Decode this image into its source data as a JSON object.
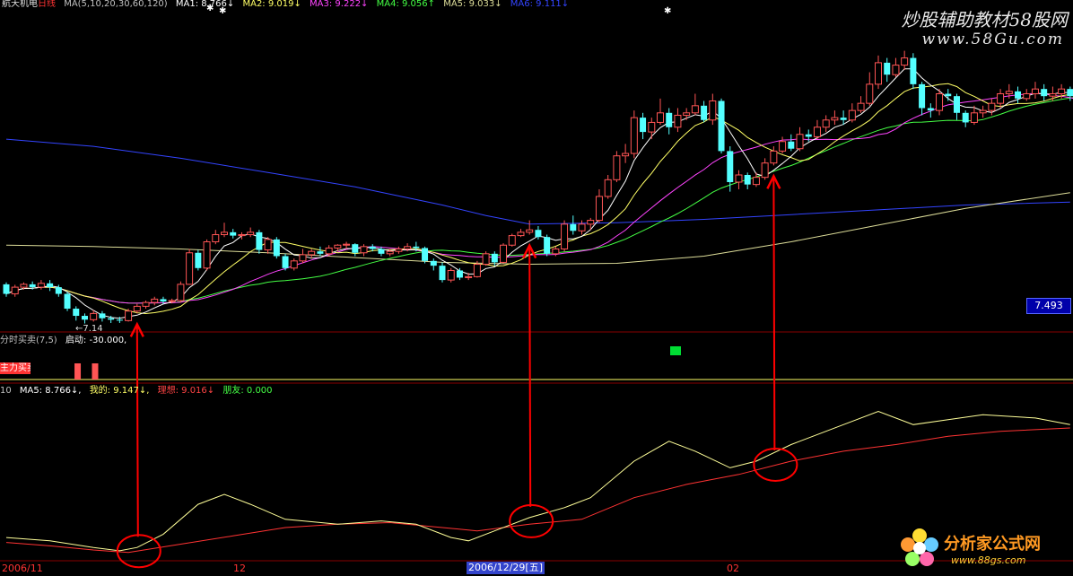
{
  "header": {
    "stock": "航天机电",
    "period": "日线",
    "ma_params": "MA(5,10,20,30,60,120)",
    "ma1": "MA1: 8.766↓",
    "ma2": "MA2: 9.019↓",
    "ma3": "MA3: 9.222↓",
    "ma4": "MA4: 9.056↑",
    "ma5": "MA5: 9.033↓",
    "ma6": "MA6: 9.111↓"
  },
  "watermark": {
    "title": "炒股辅助教材58股网",
    "url": "www.58Gu.com",
    "logo_text": "分析家公式网",
    "logo_url": "www.88gs.com"
  },
  "indicator1": {
    "title": "分时买卖(7,5)",
    "param": "启动: -30.000,",
    "tag": "主力买卖"
  },
  "indicator2": {
    "prefix": "10",
    "ma5": "MA5: 8.766↓,",
    "mine": "我的: 9.147↓,",
    "theory": "理想: 9.016↓",
    "friend": "朋友: 0.000"
  },
  "price_tag": "7.493",
  "low_label": "←7.14",
  "xaxis": {
    "nov": "2006/11",
    "dec": "12",
    "cursor_date": "2006/12/29[五]",
    "feb": "02"
  },
  "colors": {
    "up": "#ff5555",
    "down": "#54ffff",
    "ma5": "#ffffff",
    "ma10": "#ffff66",
    "ma20": "#ff44ff",
    "ma30": "#44ff44",
    "ma60": "#dddd99",
    "ma120": "#3344ff",
    "annotation": "#ff0000"
  },
  "chart_data": {
    "type": "candlestick",
    "candles": [
      [
        7.96,
        7.76,
        8.0,
        7.7
      ],
      [
        7.76,
        7.9,
        7.95,
        7.7
      ],
      [
        7.9,
        7.96,
        8.0,
        7.85
      ],
      [
        7.96,
        7.9,
        8.02,
        7.85
      ],
      [
        7.9,
        7.98,
        8.05,
        7.85
      ],
      [
        7.98,
        7.9,
        8.05,
        7.82
      ],
      [
        7.9,
        7.76,
        7.95,
        7.7
      ],
      [
        7.76,
        7.45,
        7.8,
        7.4
      ],
      [
        7.45,
        7.3,
        7.5,
        7.2
      ],
      [
        7.3,
        7.22,
        7.35,
        7.14
      ],
      [
        7.22,
        7.35,
        7.42,
        7.18
      ],
      [
        7.35,
        7.25,
        7.4,
        7.18
      ],
      [
        7.25,
        7.22,
        7.3,
        7.15
      ],
      [
        7.22,
        7.2,
        7.28,
        7.15
      ],
      [
        7.2,
        7.4,
        7.45,
        7.18
      ],
      [
        7.4,
        7.5,
        7.55,
        7.35
      ],
      [
        7.5,
        7.58,
        7.62,
        7.45
      ],
      [
        7.58,
        7.65,
        7.7,
        7.52
      ],
      [
        7.65,
        7.6,
        7.7,
        7.55
      ],
      [
        7.6,
        7.62,
        7.66,
        7.56
      ],
      [
        7.62,
        7.96,
        8.02,
        7.58
      ],
      [
        7.96,
        8.62,
        8.7,
        7.95
      ],
      [
        8.62,
        8.3,
        8.68,
        8.25
      ],
      [
        8.3,
        8.85,
        8.9,
        8.25
      ],
      [
        8.85,
        9.0,
        9.1,
        8.8
      ],
      [
        9.0,
        9.05,
        9.25,
        8.95
      ],
      [
        9.05,
        8.98,
        9.12,
        8.92
      ],
      [
        8.98,
        9.0,
        9.05,
        8.9
      ],
      [
        9.0,
        9.05,
        9.15,
        8.95
      ],
      [
        9.05,
        8.68,
        9.1,
        8.6
      ],
      [
        8.68,
        8.9,
        8.95,
        8.6
      ],
      [
        8.9,
        8.55,
        8.95,
        8.5
      ],
      [
        8.55,
        8.3,
        8.6,
        8.25
      ],
      [
        8.3,
        8.45,
        8.5,
        8.25
      ],
      [
        8.45,
        8.58,
        8.7,
        8.4
      ],
      [
        8.58,
        8.65,
        8.7,
        8.5
      ],
      [
        8.65,
        8.6,
        8.75,
        8.55
      ],
      [
        8.6,
        8.72,
        8.78,
        8.55
      ],
      [
        8.72,
        8.78,
        8.8,
        8.65
      ],
      [
        8.78,
        8.8,
        8.85,
        8.7
      ],
      [
        8.8,
        8.62,
        8.82,
        8.55
      ],
      [
        8.62,
        8.75,
        8.8,
        8.55
      ],
      [
        8.75,
        8.7,
        8.8,
        8.65
      ],
      [
        8.7,
        8.6,
        8.75,
        8.55
      ],
      [
        8.6,
        8.65,
        8.7,
        8.55
      ],
      [
        8.65,
        8.7,
        8.75,
        8.6
      ],
      [
        8.7,
        8.75,
        8.82,
        8.65
      ],
      [
        8.75,
        8.72,
        8.85,
        8.65
      ],
      [
        8.72,
        8.45,
        8.75,
        8.4
      ],
      [
        8.45,
        8.35,
        8.5,
        8.25
      ],
      [
        8.35,
        8.05,
        8.42,
        8.0
      ],
      [
        8.05,
        8.25,
        8.3,
        8.0
      ],
      [
        8.25,
        8.1,
        8.3,
        8.05
      ],
      [
        8.1,
        8.12,
        8.2,
        8.05
      ],
      [
        8.12,
        8.38,
        8.45,
        8.1
      ],
      [
        8.38,
        8.6,
        8.65,
        8.35
      ],
      [
        8.6,
        8.42,
        8.65,
        8.35
      ],
      [
        8.42,
        8.78,
        8.82,
        8.4
      ],
      [
        8.78,
        8.98,
        9.02,
        8.75
      ],
      [
        8.98,
        9.05,
        9.12,
        8.95
      ],
      [
        9.05,
        9.1,
        9.3,
        9.0
      ],
      [
        9.1,
        8.95,
        9.18,
        8.9
      ],
      [
        8.95,
        8.6,
        9.0,
        8.55
      ],
      [
        8.6,
        8.7,
        8.75,
        8.55
      ],
      [
        8.7,
        9.22,
        9.3,
        8.65
      ],
      [
        9.22,
        9.08,
        9.4,
        9.0
      ],
      [
        9.08,
        9.22,
        9.3,
        9.0
      ],
      [
        9.22,
        9.3,
        9.35,
        9.1
      ],
      [
        9.3,
        9.8,
        9.95,
        9.25
      ],
      [
        9.8,
        10.15,
        10.25,
        9.75
      ],
      [
        10.15,
        10.65,
        10.75,
        10.1
      ],
      [
        10.65,
        10.7,
        10.9,
        10.5
      ],
      [
        10.7,
        11.45,
        11.6,
        10.6
      ],
      [
        11.45,
        11.15,
        11.55,
        11.0
      ],
      [
        11.15,
        11.35,
        11.45,
        11.0
      ],
      [
        11.35,
        11.55,
        11.85,
        11.3
      ],
      [
        11.55,
        11.25,
        11.65,
        11.1
      ],
      [
        11.25,
        11.5,
        11.65,
        11.15
      ],
      [
        11.5,
        11.55,
        11.65,
        11.4
      ],
      [
        11.55,
        11.7,
        11.95,
        11.5
      ],
      [
        11.7,
        11.4,
        11.8,
        11.35
      ],
      [
        11.4,
        11.8,
        11.95,
        11.3
      ],
      [
        11.8,
        10.75,
        11.85,
        10.7
      ],
      [
        10.75,
        10.1,
        10.85,
        9.9
      ],
      [
        10.1,
        10.25,
        10.35,
        9.95
      ],
      [
        10.25,
        10.05,
        10.3,
        9.95
      ],
      [
        10.05,
        10.2,
        10.3,
        10.0
      ],
      [
        10.2,
        10.5,
        10.6,
        10.15
      ],
      [
        10.5,
        10.75,
        10.85,
        10.45
      ],
      [
        10.75,
        10.95,
        11.05,
        10.7
      ],
      [
        10.95,
        10.8,
        11.1,
        10.75
      ],
      [
        10.8,
        11.1,
        11.25,
        10.75
      ],
      [
        11.1,
        11.05,
        11.2,
        10.95
      ],
      [
        11.05,
        11.25,
        11.4,
        11.0
      ],
      [
        11.25,
        11.4,
        11.5,
        11.15
      ],
      [
        11.4,
        11.45,
        11.6,
        11.3
      ],
      [
        11.45,
        11.4,
        11.6,
        11.3
      ],
      [
        11.4,
        11.6,
        11.75,
        11.35
      ],
      [
        11.6,
        11.75,
        11.9,
        11.55
      ],
      [
        11.75,
        12.15,
        12.4,
        11.7
      ],
      [
        12.15,
        12.6,
        12.75,
        12.05
      ],
      [
        12.6,
        12.35,
        12.7,
        12.2
      ],
      [
        12.35,
        12.55,
        12.7,
        12.3
      ],
      [
        12.55,
        12.7,
        12.85,
        12.45
      ],
      [
        12.7,
        12.15,
        12.8,
        12.05
      ],
      [
        12.15,
        11.65,
        12.2,
        11.5
      ],
      [
        11.65,
        11.6,
        11.75,
        11.45
      ],
      [
        11.6,
        11.95,
        12.05,
        11.5
      ],
      [
        11.95,
        11.9,
        12.05,
        11.8
      ],
      [
        11.9,
        11.55,
        11.95,
        11.4
      ],
      [
        11.55,
        11.35,
        11.6,
        11.25
      ],
      [
        11.35,
        11.55,
        11.7,
        11.3
      ],
      [
        11.55,
        11.6,
        11.7,
        11.45
      ],
      [
        11.6,
        11.75,
        11.85,
        11.5
      ],
      [
        11.75,
        11.95,
        12.05,
        11.65
      ],
      [
        11.95,
        12.0,
        12.15,
        11.85
      ],
      [
        12.0,
        11.85,
        12.1,
        11.75
      ],
      [
        11.85,
        11.95,
        12.05,
        11.8
      ],
      [
        11.95,
        12.05,
        12.2,
        11.85
      ],
      [
        12.05,
        11.9,
        12.15,
        11.8
      ],
      [
        11.9,
        11.95,
        12.1,
        11.8
      ],
      [
        11.95,
        12.05,
        12.15,
        11.85
      ],
      [
        12.05,
        11.9,
        12.1,
        11.8
      ],
      [
        11.9,
        11.95,
        12.05,
        11.85
      ],
      [
        11.95,
        11.5,
        12.0,
        11.4
      ],
      [
        11.5,
        11.35,
        11.6,
        11.25
      ],
      [
        11.35,
        11.7,
        11.8,
        11.3
      ],
      [
        11.7,
        11.9,
        11.95,
        11.6
      ]
    ],
    "ma60": [
      [
        0,
        8.78
      ],
      [
        10,
        8.75
      ],
      [
        20,
        8.7
      ],
      [
        30,
        8.62
      ],
      [
        40,
        8.52
      ],
      [
        50,
        8.42
      ],
      [
        60,
        8.38
      ],
      [
        70,
        8.4
      ],
      [
        80,
        8.55
      ],
      [
        90,
        8.85
      ],
      [
        100,
        9.2
      ],
      [
        110,
        9.55
      ],
      [
        122,
        9.88
      ]
    ],
    "ma120": [
      [
        0,
        11.0
      ],
      [
        10,
        10.85
      ],
      [
        20,
        10.6
      ],
      [
        30,
        10.3
      ],
      [
        40,
        10.0
      ],
      [
        50,
        9.62
      ],
      [
        55,
        9.4
      ],
      [
        60,
        9.22
      ],
      [
        70,
        9.25
      ],
      [
        80,
        9.32
      ],
      [
        90,
        9.42
      ],
      [
        100,
        9.52
      ],
      [
        110,
        9.62
      ],
      [
        122,
        9.68
      ]
    ],
    "indicator_mine": [
      [
        0,
        0.14
      ],
      [
        5,
        0.12
      ],
      [
        10,
        0.08
      ],
      [
        13,
        0.06
      ],
      [
        15,
        0.08
      ],
      [
        18,
        0.16
      ],
      [
        22,
        0.34
      ],
      [
        25,
        0.4
      ],
      [
        28,
        0.34
      ],
      [
        32,
        0.25
      ],
      [
        38,
        0.22
      ],
      [
        43,
        0.24
      ],
      [
        47,
        0.22
      ],
      [
        51,
        0.14
      ],
      [
        53,
        0.12
      ],
      [
        56,
        0.18
      ],
      [
        60,
        0.26
      ],
      [
        64,
        0.32
      ],
      [
        67,
        0.38
      ],
      [
        72,
        0.6
      ],
      [
        76,
        0.72
      ],
      [
        79,
        0.66
      ],
      [
        83,
        0.56
      ],
      [
        86,
        0.6
      ],
      [
        90,
        0.7
      ],
      [
        96,
        0.82
      ],
      [
        100,
        0.9
      ],
      [
        104,
        0.82
      ],
      [
        108,
        0.85
      ],
      [
        112,
        0.88
      ],
      [
        118,
        0.86
      ],
      [
        122,
        0.82
      ]
    ],
    "indicator_theory": [
      [
        0,
        0.11
      ],
      [
        5,
        0.09
      ],
      [
        10,
        0.065
      ],
      [
        14,
        0.05
      ],
      [
        20,
        0.1
      ],
      [
        26,
        0.15
      ],
      [
        32,
        0.2
      ],
      [
        38,
        0.22
      ],
      [
        44,
        0.23
      ],
      [
        50,
        0.2
      ],
      [
        54,
        0.18
      ],
      [
        60,
        0.22
      ],
      [
        66,
        0.25
      ],
      [
        72,
        0.38
      ],
      [
        78,
        0.46
      ],
      [
        84,
        0.52
      ],
      [
        90,
        0.6
      ],
      [
        96,
        0.66
      ],
      [
        102,
        0.7
      ],
      [
        108,
        0.75
      ],
      [
        114,
        0.78
      ],
      [
        122,
        0.8
      ]
    ],
    "arrows_at_index": [
      15,
      60,
      88
    ],
    "signal_bars_at_index": [
      7,
      9
    ],
    "price_range": [
      7.0,
      13.5
    ],
    "indicator_range": [
      0,
      1
    ]
  }
}
